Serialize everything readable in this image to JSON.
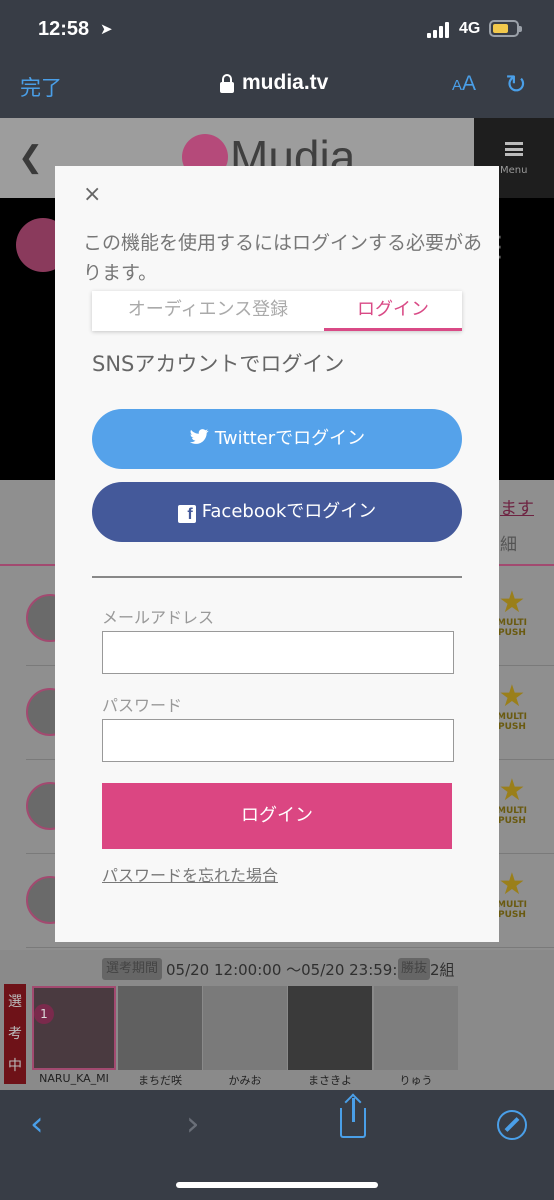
{
  "status_bar": {
    "time": "12:58",
    "network": "4G"
  },
  "browser": {
    "done_label": "完了",
    "url": "mudia.tv",
    "text_size_label": "AA"
  },
  "page_header": {
    "logo_text": "Mudia",
    "menu_label": "Menu"
  },
  "background": {
    "link_text": "ます",
    "tab_text": "細",
    "badge_label_1": "MULTI",
    "badge_label_2": "PUSH",
    "selection_period_label": "選考期間",
    "selection_period_value": "05/20 12:00:00 〜05/20 23:59:59",
    "winners_label": "勝抜",
    "winners_value": "2組",
    "side_label": [
      "選",
      "考",
      "中"
    ],
    "rank_number": "1",
    "candidates": [
      "NARU_KA_MI",
      "まちだ咲",
      "かみお",
      "まさきよ",
      "りゅう"
    ]
  },
  "modal": {
    "close_symbol": "×",
    "message": "この機能を使用するにはログインする必要があります。",
    "tabs": {
      "register": "オーディエンス登録",
      "login": "ログイン"
    },
    "sns_heading": "SNSアカウントでログイン",
    "twitter_button": "Twitterでログイン",
    "facebook_button": "Facebookでログイン",
    "email_label": "メールアドレス",
    "email_value": "",
    "password_label": "パスワード",
    "password_value": "",
    "login_button": "ログイン",
    "forgot_password": "パスワードを忘れた場合"
  },
  "colors": {
    "accent_pink": "#db4682",
    "twitter_blue": "#55a2ea",
    "facebook_blue": "#44599a",
    "ios_blue": "#4a9fe8"
  }
}
